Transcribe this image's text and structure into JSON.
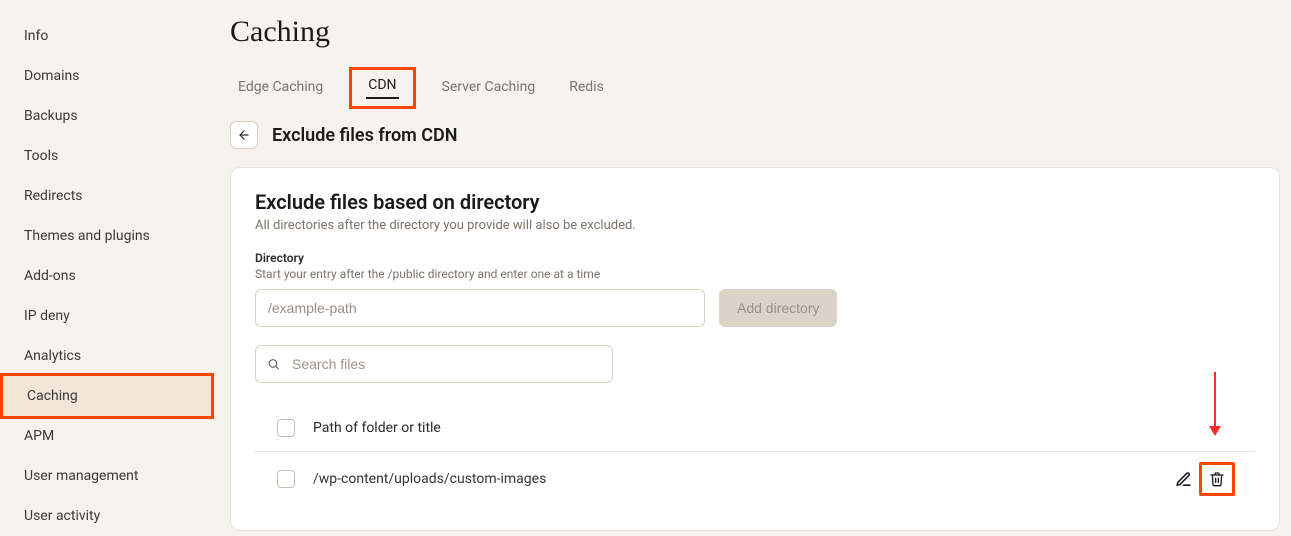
{
  "sidebar": {
    "items": [
      {
        "label": "Info"
      },
      {
        "label": "Domains"
      },
      {
        "label": "Backups"
      },
      {
        "label": "Tools"
      },
      {
        "label": "Redirects"
      },
      {
        "label": "Themes and plugins"
      },
      {
        "label": "Add-ons"
      },
      {
        "label": "IP deny"
      },
      {
        "label": "Analytics"
      },
      {
        "label": "Caching"
      },
      {
        "label": "APM"
      },
      {
        "label": "User management"
      },
      {
        "label": "User activity"
      }
    ],
    "active": "Caching"
  },
  "page": {
    "title": "Caching"
  },
  "tabs": {
    "items": [
      {
        "label": "Edge Caching"
      },
      {
        "label": "CDN"
      },
      {
        "label": "Server Caching"
      },
      {
        "label": "Redis"
      }
    ],
    "active": "CDN"
  },
  "subhead": {
    "title": "Exclude files from CDN"
  },
  "card": {
    "title": "Exclude files based on directory",
    "desc": "All directories after the directory you provide will also be excluded.",
    "directory": {
      "label": "Directory",
      "hint": "Start your entry after the /public directory and enter one at a time",
      "placeholder": "/example-path",
      "add_label": "Add directory"
    },
    "search": {
      "placeholder": "Search files"
    },
    "list": {
      "header_label": "Path of folder or title",
      "rows": [
        {
          "path": "/wp-content/uploads/custom-images"
        }
      ]
    }
  }
}
